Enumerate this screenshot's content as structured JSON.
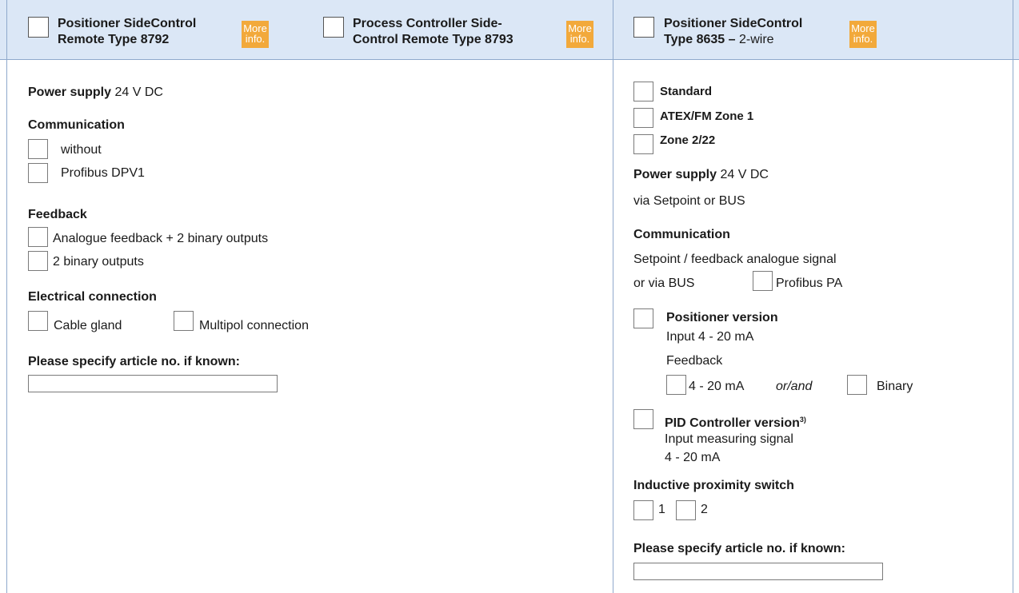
{
  "header": {
    "col1": {
      "title_line1": "Positioner SideControl",
      "title_line2": "Remote Type 8792",
      "more_line1": "More",
      "more_line2": "info."
    },
    "col2": {
      "title_line1": "Process Controller Side-",
      "title_line2": "Control Remote Type 8793",
      "more_line1": "More",
      "more_line2": "info."
    },
    "col3": {
      "title_line1": "Positioner SideControl",
      "title_line2_bold": "Type 8635 –",
      "title_line2_rest": " 2-wire",
      "more_line1": "More",
      "more_line2": "info."
    }
  },
  "left": {
    "power_supply_label": "Power supply",
    "power_supply_value": "24 V DC",
    "communication_heading": "Communication",
    "communication_options": [
      "without",
      "Profibus DPV1"
    ],
    "feedback_heading": "Feedback",
    "feedback_options": [
      "Analogue feedback + 2 binary outputs",
      "2 binary outputs"
    ],
    "electrical_heading": "Electrical connection",
    "electrical_options": [
      "Cable gland",
      "Multipol connection"
    ],
    "article_label": "Please specify article no. if known:",
    "article_value": ""
  },
  "right": {
    "variants": [
      "Standard",
      "ATEX/FM Zone 1",
      "Zone 2/22"
    ],
    "power_supply_label": "Power supply",
    "power_supply_value": "24 V DC",
    "power_supply_note": "via Setpoint or BUS",
    "communication_heading": "Communication",
    "communication_line1": "Setpoint / feedback analogue signal",
    "communication_line2": "or via BUS",
    "communication_option": "Profibus PA",
    "positioner_heading": "Positioner version",
    "positioner_input": "Input 4 - 20 mA",
    "positioner_feedback": "Feedback",
    "positioner_feedback_opt1": "4 - 20 mA",
    "positioner_feedback_join": "or/and",
    "positioner_feedback_opt2": "Binary",
    "pid_heading": "PID Controller version",
    "pid_sup": "3)",
    "pid_line1": "Input measuring signal",
    "pid_line2": "4 - 20 mA",
    "proximity_heading": "Inductive proximity switch",
    "proximity_options": [
      "1",
      "2"
    ],
    "article_label": "Please specify article no. if known:",
    "article_value": ""
  },
  "colors": {
    "header_bg": "#dbe7f6",
    "border": "#8fa9cc",
    "more_badge": "#f2a93b"
  }
}
